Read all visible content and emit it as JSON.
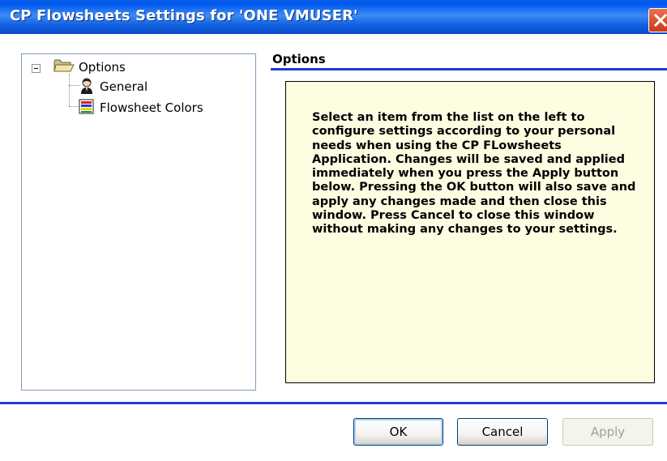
{
  "window": {
    "title": "CP Flowsheets Settings for 'ONE VMUSER'"
  },
  "tree": {
    "root": {
      "label": "Options",
      "expander": "⊟",
      "icon": "open-folder-icon"
    },
    "children": [
      {
        "label": "General",
        "icon": "person-icon"
      },
      {
        "label": "Flowsheet Colors",
        "icon": "color-bars-icon"
      }
    ]
  },
  "panel": {
    "header": "Options",
    "info_text": "Select an item from the list on the left to configure settings according to your personal needs when using the CP FLowsheets Application. Changes will be saved and applied immediately when you press the Apply button below. Pressing the OK button will also save and apply any changes made and then close this window. Press Cancel to close this window without making any changes to your settings."
  },
  "buttons": {
    "ok": "OK",
    "cancel": "Cancel",
    "apply": "Apply"
  },
  "colors": {
    "titlebar": "#0a5ee8",
    "accent_rule": "#1b3ed3",
    "info_background": "#fdfde2",
    "close_button": "#d9502e"
  }
}
